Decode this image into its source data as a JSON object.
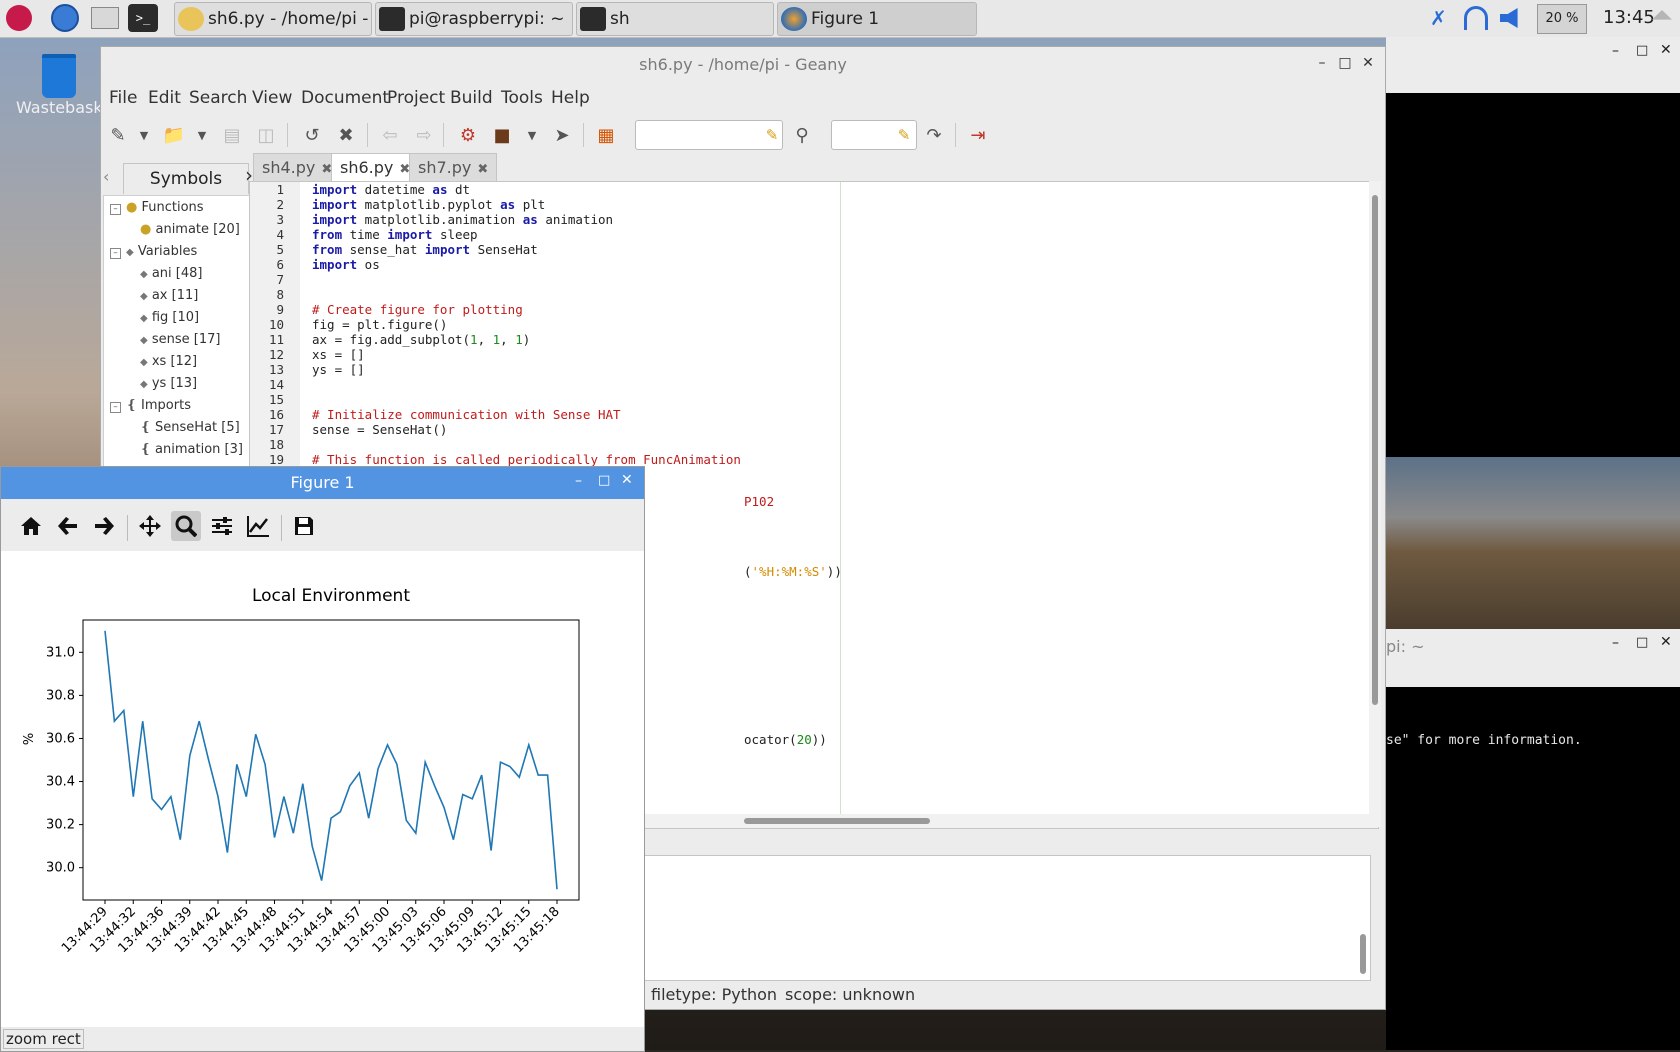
{
  "taskbar": {
    "tasks": [
      {
        "label": "sh6.py - /home/pi - G..."
      },
      {
        "label": "pi@raspberrypi: ~"
      },
      {
        "label": "sh"
      },
      {
        "label": "Figure 1"
      }
    ],
    "cpu": "20 %",
    "clock": "13:45"
  },
  "desktop": {
    "wastebasket": "Wastebasket"
  },
  "geany": {
    "title": "sh6.py - /home/pi - Geany",
    "menu": [
      "File",
      "Edit",
      "Search",
      "View",
      "Document",
      "Project",
      "Build",
      "Tools",
      "Help"
    ],
    "symbols_tab": "Symbols",
    "tree": {
      "functions": "Functions",
      "animate": "animate [20]",
      "variables": "Variables",
      "vars": [
        "ani [48]",
        "ax [11]",
        "fig [10]",
        "sense [17]",
        "xs [12]",
        "ys [13]"
      ],
      "imports": "Imports",
      "imps": [
        "SenseHat [5]",
        "animation [3]"
      ]
    },
    "tabs": [
      {
        "label": "sh4.py"
      },
      {
        "label": "sh6.py"
      },
      {
        "label": "sh7.py"
      }
    ],
    "status": {
      "filetype": "filetype: Python",
      "scope": "scope: unknown"
    }
  },
  "code": {
    "line_numbers": [
      "1",
      "2",
      "3",
      "4",
      "5",
      "6",
      "7",
      "8",
      "9",
      "10",
      "11",
      "12",
      "13",
      "14",
      "15",
      "16",
      "17",
      "18",
      "19"
    ],
    "l1_kw": "import",
    "l1_rest": " datetime ",
    "l1_kw2": "as",
    "l1_end": " dt",
    "l2_kw": "import",
    "l2_rest": " matplotlib.pyplot ",
    "l2_kw2": "as",
    "l2_end": " plt",
    "l3_kw": "import",
    "l3_rest": " matplotlib.animation ",
    "l3_kw2": "as",
    "l3_end": " animation",
    "l4_kw": "from",
    "l4_rest": " time ",
    "l4_kw2": "import",
    "l4_end": " sleep",
    "l5_kw": "from",
    "l5_rest": " sense_hat ",
    "l5_kw2": "import",
    "l5_end": " SenseHat",
    "l6_kw": "import",
    "l6_end": " os",
    "l9": "# Create figure for plotting",
    "l10": "fig = plt.figure()",
    "l11_a": "ax = fig.add_subplot(",
    "l11_n1": "1",
    "l11_c1": ", ",
    "l11_n2": "1",
    "l11_c2": ", ",
    "l11_n3": "1",
    "l11_b": ")",
    "l12": "xs = []",
    "l13": "ys = []",
    "l16": "# Initialize communication with Sense HAT",
    "l17": "sense = SenseHat()",
    "l19": "# This function is called periodically from FuncAnimation",
    "frag1": "P102",
    "frag2_a": "(",
    "frag2_s": "'%H:%M:%S'",
    "frag2_b": "))",
    "frag3_a": "ocator(",
    "frag3_n": "20",
    "frag3_b": "))"
  },
  "terminal": {
    "title_fragment": "pi: ~",
    "text": "se\" for more information."
  },
  "figure": {
    "window_title": "Figure 1",
    "status": "zoom rect"
  },
  "chart_data": {
    "type": "line",
    "title": "Local Environment",
    "ylabel": "%",
    "xlabel": "",
    "x": [
      "13:44:29",
      "13:44:30",
      "13:44:31",
      "13:44:32",
      "13:44:33",
      "13:44:34",
      "13:44:35",
      "13:44:36",
      "13:44:37",
      "13:44:38",
      "13:44:39",
      "13:44:40",
      "13:44:41",
      "13:44:42",
      "13:44:43",
      "13:44:44",
      "13:44:45",
      "13:44:46",
      "13:44:47",
      "13:44:48",
      "13:44:49",
      "13:44:50",
      "13:44:51",
      "13:44:52",
      "13:44:53",
      "13:44:54",
      "13:44:55",
      "13:44:56",
      "13:44:57",
      "13:44:58",
      "13:44:59",
      "13:45:00",
      "13:45:01",
      "13:45:02",
      "13:45:03",
      "13:45:04",
      "13:45:05",
      "13:45:06",
      "13:45:07",
      "13:45:08",
      "13:45:09",
      "13:45:10",
      "13:45:11",
      "13:45:12",
      "13:45:13",
      "13:45:14",
      "13:45:15",
      "13:45:16",
      "13:45:17",
      "13:45:18",
      "13:45:19"
    ],
    "values": [
      31.1,
      30.68,
      30.73,
      30.33,
      30.68,
      30.32,
      30.27,
      30.33,
      30.13,
      30.52,
      30.68,
      30.5,
      30.33,
      30.07,
      30.48,
      30.33,
      30.62,
      30.48,
      30.14,
      30.33,
      30.16,
      30.39,
      30.1,
      29.94,
      30.23,
      30.26,
      30.38,
      30.44,
      30.23,
      30.46,
      30.57,
      30.48,
      30.22,
      30.16,
      30.49,
      30.38,
      30.28,
      30.13,
      30.34,
      30.32,
      30.43,
      30.08,
      30.49,
      30.47,
      30.42,
      30.57,
      30.43,
      30.43,
      29.9
    ],
    "xtick_labels": [
      "13:44:29",
      "13:44:32",
      "13:44:36",
      "13:44:39",
      "13:44:42",
      "13:44:45",
      "13:44:48",
      "13:44:51",
      "13:44:54",
      "13:44:57",
      "13:45:00",
      "13:45:03",
      "13:45:06",
      "13:45:09",
      "13:45:12",
      "13:45:15",
      "13:45:18"
    ],
    "yticks": [
      30.0,
      30.2,
      30.4,
      30.6,
      30.8,
      31.0
    ],
    "ytick_labels": [
      "30.0",
      "30.2",
      "30.4",
      "30.6",
      "30.8",
      "31.0"
    ],
    "ylim": [
      29.85,
      31.15
    ],
    "grid": false,
    "line_color": "#1f77b4"
  }
}
